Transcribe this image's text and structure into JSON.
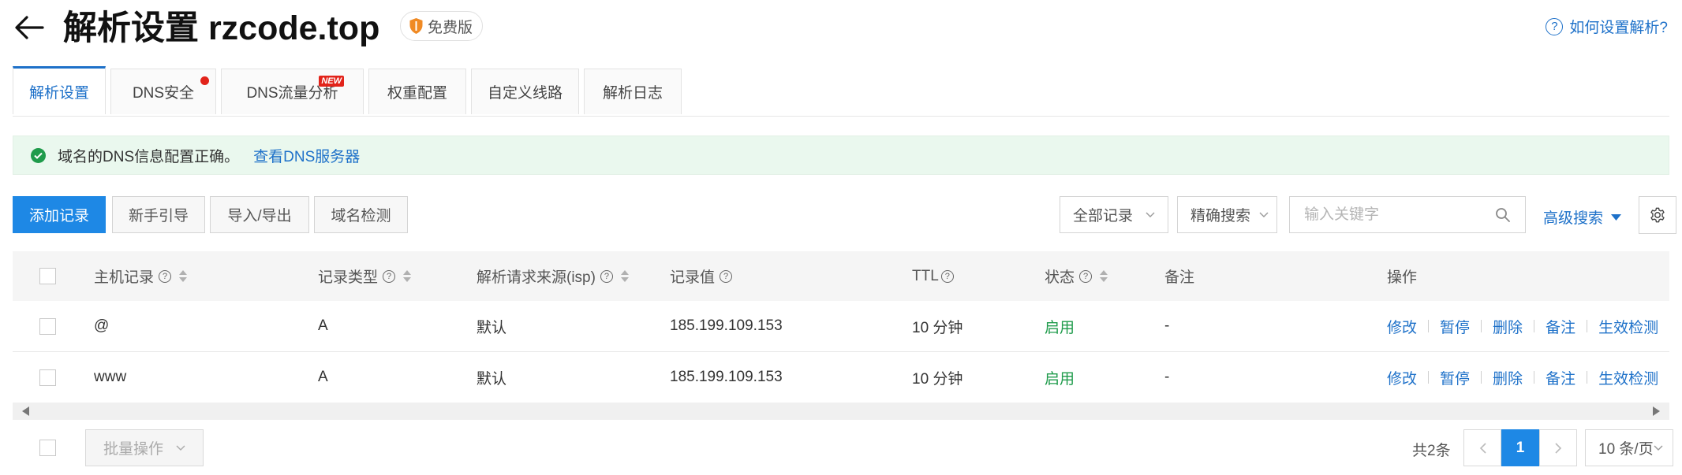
{
  "header": {
    "title": "解析设置 rzcode.top",
    "badge": "免费版",
    "help_link": "如何设置解析?"
  },
  "tabs": [
    {
      "label": "解析设置",
      "active": true
    },
    {
      "label": "DNS安全",
      "dot": true
    },
    {
      "label": "DNS流量分析",
      "tag": "NEW"
    },
    {
      "label": "权重配置"
    },
    {
      "label": "自定义线路"
    },
    {
      "label": "解析日志"
    }
  ],
  "alert": {
    "message": "域名的DNS信息配置正确。",
    "link": "查看DNS服务器"
  },
  "toolbar": {
    "add_record": "添加记录",
    "guide": "新手引导",
    "import_export": "导入/导出",
    "domain_check": "域名检测",
    "filter_select": "全部记录",
    "search_mode": "精确搜索",
    "search_placeholder": "输入关键字",
    "advanced_search": "高级搜索"
  },
  "table": {
    "columns": {
      "host": "主机记录",
      "type": "记录类型",
      "isp": "解析请求来源(isp)",
      "value": "记录值",
      "ttl": "TTL",
      "status": "状态",
      "remark": "备注",
      "actions": "操作"
    },
    "rows": [
      {
        "host": "@",
        "type": "A",
        "isp": "默认",
        "value": "185.199.109.153",
        "ttl": "10 分钟",
        "status": "启用",
        "remark": "-"
      },
      {
        "host": "www",
        "type": "A",
        "isp": "默认",
        "value": "185.199.109.153",
        "ttl": "10 分钟",
        "status": "启用",
        "remark": "-"
      }
    ],
    "row_actions": [
      "修改",
      "暂停",
      "删除",
      "备注",
      "生效检测"
    ]
  },
  "footer": {
    "bulk_action": "批量操作",
    "total": "共2条",
    "current_page": "1",
    "page_size": "10 条/页"
  },
  "colors": {
    "accent": "#1e88e5",
    "link": "#1e71c9",
    "success": "#1f9b4b",
    "danger": "#e2231a",
    "alert_bg": "#eaf8ee"
  }
}
